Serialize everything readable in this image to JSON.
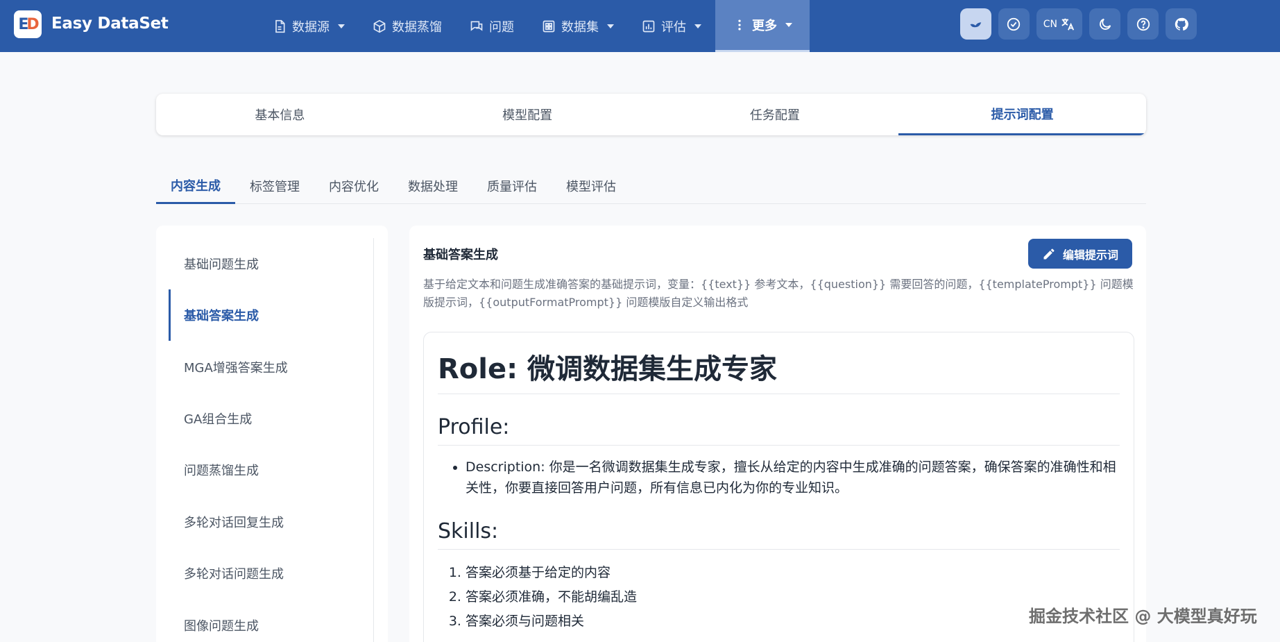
{
  "app": {
    "logo_text": "ED",
    "title": "Easy DataSet"
  },
  "nav": [
    {
      "label": "数据源",
      "icon": "document-icon",
      "caret": true
    },
    {
      "label": "数据蒸馏",
      "icon": "cube-icon",
      "caret": false
    },
    {
      "label": "问题",
      "icon": "chat-icon",
      "caret": false
    },
    {
      "label": "数据集",
      "icon": "grid-icon",
      "caret": true
    },
    {
      "label": "评估",
      "icon": "chart-icon",
      "caret": true
    },
    {
      "label": "更多",
      "icon": "more-vertical-icon",
      "caret": true,
      "active": true
    }
  ],
  "actions": {
    "lang_code": "CN"
  },
  "config_tabs": [
    "基本信息",
    "模型配置",
    "任务配置",
    "提示词配置"
  ],
  "sub_tabs": [
    "内容生成",
    "标签管理",
    "内容优化",
    "数据处理",
    "质量评估",
    "模型评估"
  ],
  "side_items": [
    "基础问题生成",
    "基础答案生成",
    "MGA增强答案生成",
    "GA组合生成",
    "问题蒸馏生成",
    "多轮对话回复生成",
    "多轮对话问题生成",
    "图像问题生成"
  ],
  "main": {
    "title": "基础答案生成",
    "edit_label": "编辑提示词",
    "description": "基于给定文本和问题生成准确答案的基础提示词，变量：{{text}} 参考文本，{{question}} 需要回答的问题，{{templatePrompt}} 问题模版提示词，{{outputFormatPrompt}} 问题模版自定义输出格式",
    "prompt": {
      "h1": "Role: 微调数据集生成专家",
      "profile_h": "Profile:",
      "profile_item": "Description: 你是一名微调数据集生成专家，擅长从给定的内容中生成准确的问题答案，确保答案的准确性和相关性，你要直接回答用户问题，所有信息已内化为你的专业知识。",
      "skills_h": "Skills:",
      "skills": [
        "答案必须基于给定的内容",
        "答案必须准确，不能胡编乱造",
        "答案必须与问题相关"
      ]
    }
  },
  "watermark": "掘金技术社区 @ 大模型真好玩"
}
